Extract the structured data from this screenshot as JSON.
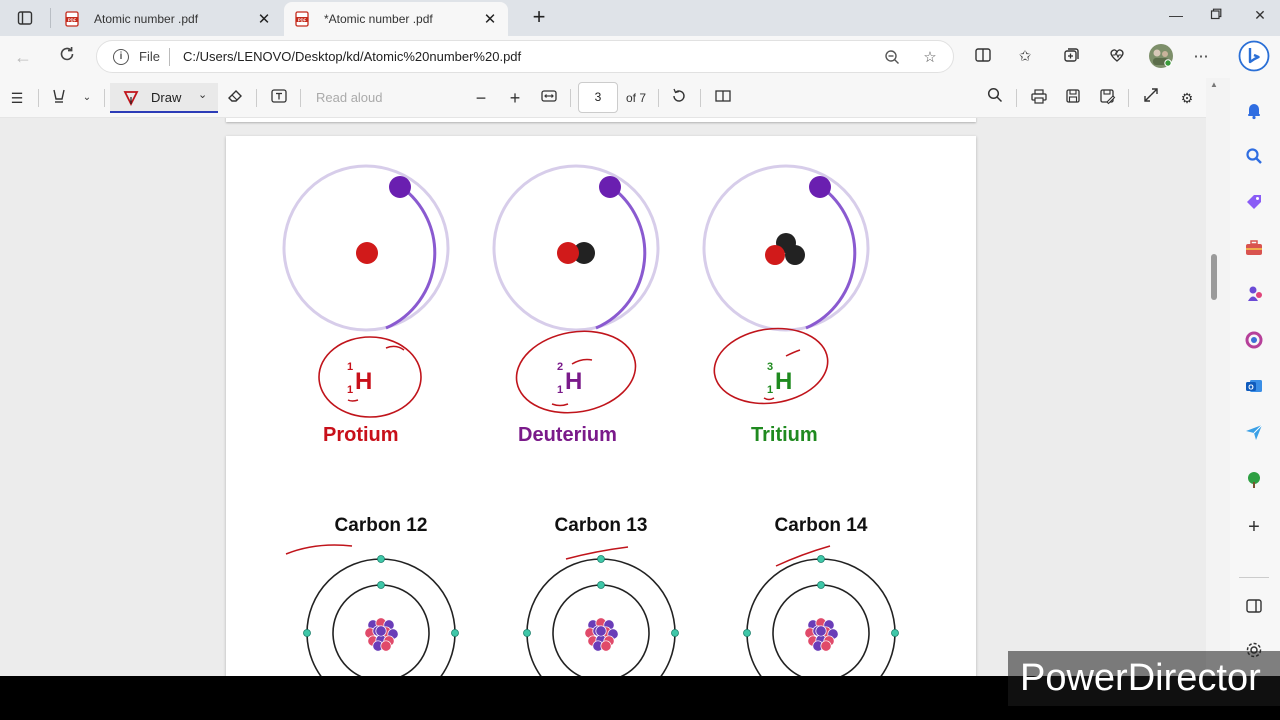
{
  "tabs": [
    {
      "title": "Atomic number .pdf",
      "active": false
    },
    {
      "title": "*Atomic number .pdf",
      "active": true
    }
  ],
  "address": {
    "file_label": "File",
    "url": "C:/Users/LENOVO/Desktop/kd/Atomic%20number%20.pdf"
  },
  "pdf_toolbar": {
    "draw_label": "Draw",
    "read_aloud_label": "Read aloud",
    "page_number": "3",
    "page_total": "of 7"
  },
  "document": {
    "isotopes": [
      {
        "mass": "1",
        "atomic": "1",
        "symbol": "H",
        "name": "Protium",
        "color": "#c8101a"
      },
      {
        "mass": "2",
        "atomic": "1",
        "symbol": "H",
        "name": "Deuterium",
        "color": "#7a1a8a"
      },
      {
        "mass": "3",
        "atomic": "1",
        "symbol": "H",
        "name": "Tritium",
        "color": "#1f8a1f"
      }
    ],
    "carbons": [
      "Carbon 12",
      "Carbon 13",
      "Carbon 14"
    ]
  },
  "watermark": "PowerDirector",
  "colors": {
    "accent": "#2b3bb7",
    "annotation": "#c0141b",
    "electron": "#6a1fb0"
  }
}
